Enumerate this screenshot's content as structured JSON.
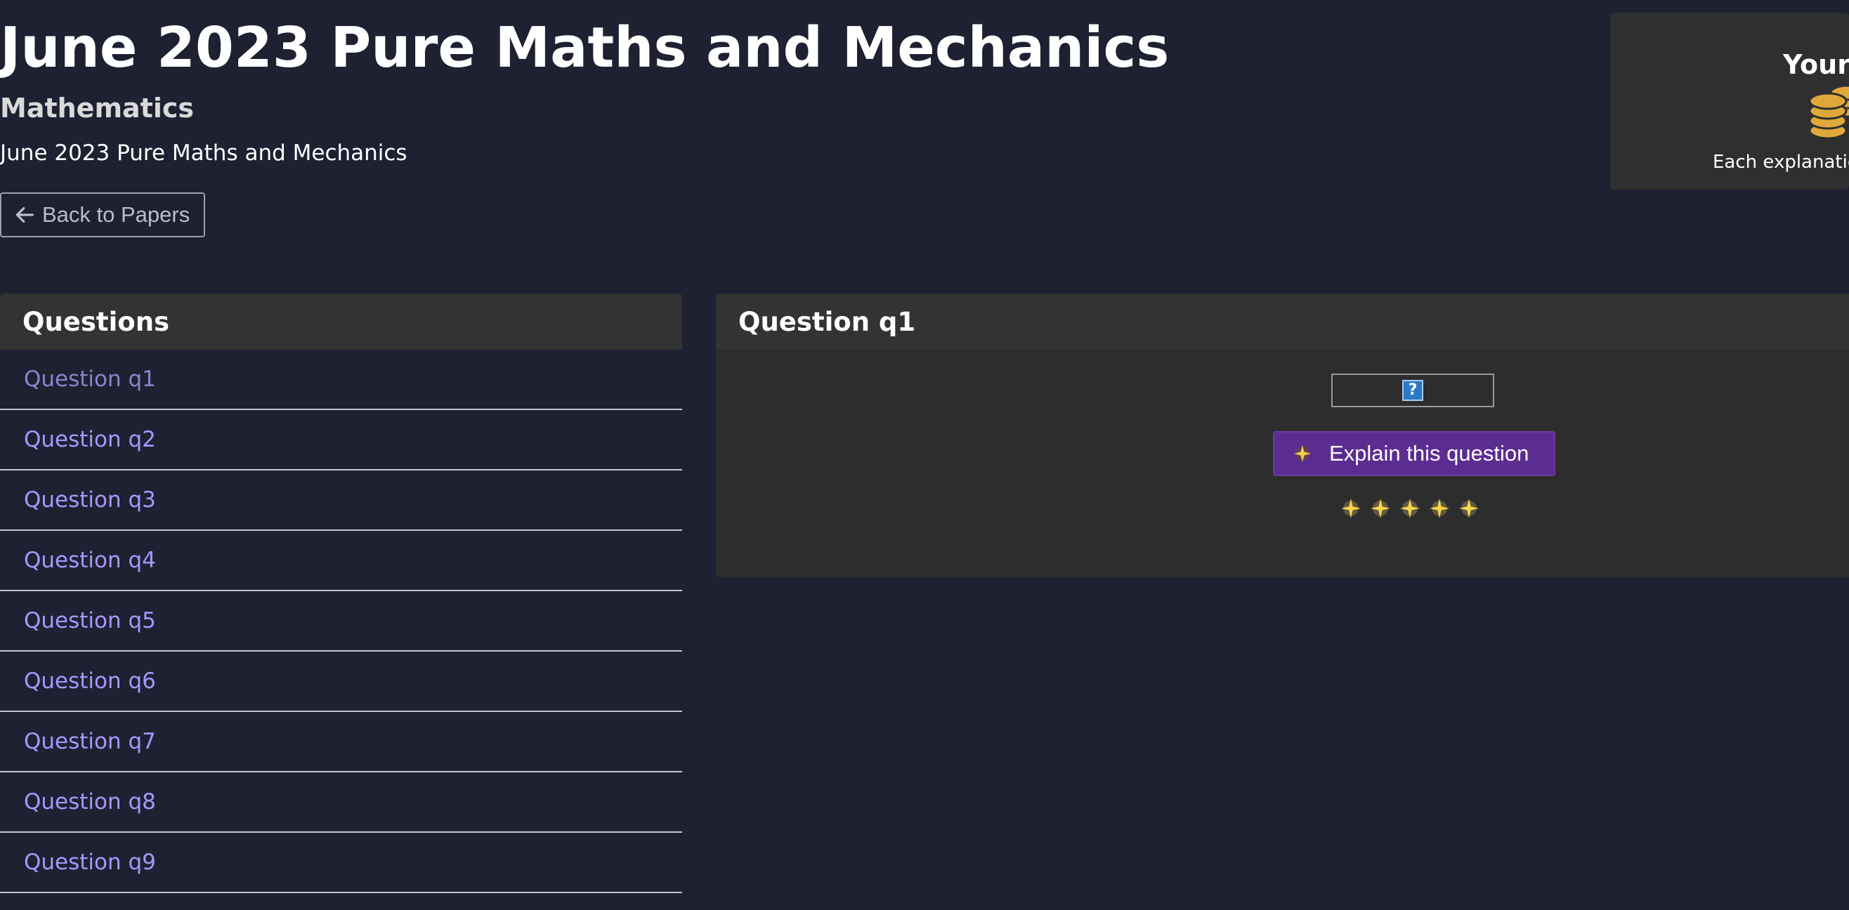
{
  "header": {
    "title": "June 2023 Pure Maths and Mechanics",
    "subject": "Mathematics",
    "paper_name": "June 2023 Pure Maths and Mechanics",
    "back_label": "Back to Papers"
  },
  "coins_card": {
    "title": "Your",
    "note": "Each explanatio",
    "icon": "coins-icon"
  },
  "questions_panel": {
    "title": "Questions",
    "items": [
      {
        "label": "Question q1"
      },
      {
        "label": "Question q2"
      },
      {
        "label": "Question q3"
      },
      {
        "label": "Question q4"
      },
      {
        "label": "Question q5"
      },
      {
        "label": "Question q6"
      },
      {
        "label": "Question q7"
      },
      {
        "label": "Question q8"
      },
      {
        "label": "Question q9"
      }
    ]
  },
  "detail": {
    "title": "Question q1",
    "image_alt_icon": "?",
    "explain_label": "Explain this question",
    "sparkle_count": 5
  },
  "colors": {
    "background": "#1e2132",
    "panel": "#2d2d2d",
    "panel_header": "#333333",
    "link": "#a996ff",
    "button_purple": "#5c2d91",
    "coin_gold": "#e0a83a"
  }
}
